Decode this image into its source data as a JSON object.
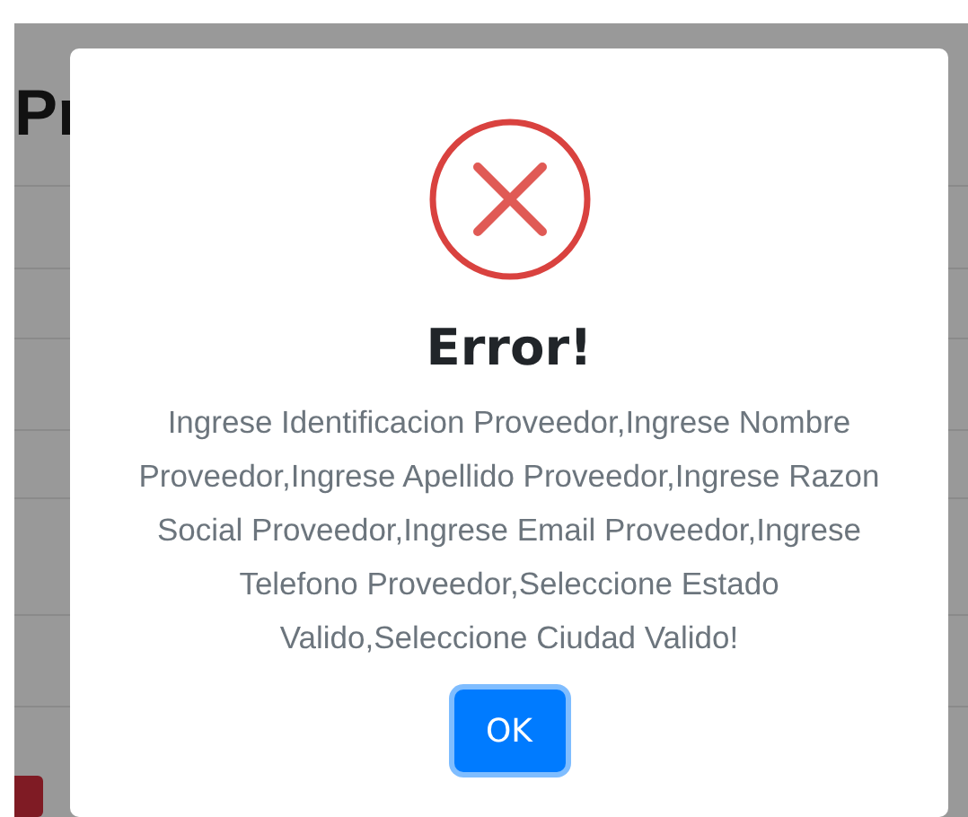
{
  "page": {
    "heading": "Pr"
  },
  "dialog": {
    "kind": "error",
    "title": "Error!",
    "message": "Ingrese Identificacion Proveedor,Ingrese Nombre Proveedor,Ingrese Apellido Proveedor,Ingrese Razon Social Proveedor,Ingrese Email Proveedor,Ingrese Telefono Proveedor,Seleccione Estado Valido,Seleccione Ciudad Valido!",
    "confirm_button": {
      "label": "OK",
      "focused": true
    }
  }
}
